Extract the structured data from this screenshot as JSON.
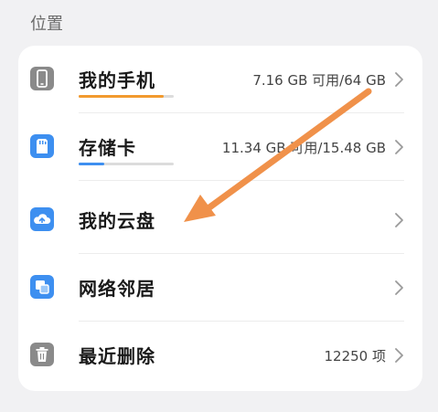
{
  "section": {
    "title": "位置"
  },
  "items": [
    {
      "label": "我的手机",
      "value": "7.16 GB 可用/64 GB",
      "icon": "phone-icon",
      "icon_color": "#8a8a8a",
      "usage_fraction": 0.89,
      "usage_color": "#f29a2e"
    },
    {
      "label": "存储卡",
      "value": "11.34 GB 可用/15.48 GB",
      "icon": "sd-card-icon",
      "icon_color": "#3d8ff0",
      "usage_fraction": 0.27,
      "usage_color": "#3d8ff0"
    },
    {
      "label": "我的云盘",
      "value": "",
      "icon": "cloud-drive-icon",
      "icon_color": "#3d8ff0"
    },
    {
      "label": "网络邻居",
      "value": "",
      "icon": "network-neighbor-icon",
      "icon_color": "#3d8ff0"
    },
    {
      "label": "最近删除",
      "value": "12250 项",
      "icon": "trash-icon",
      "icon_color": "#8a8a8a"
    }
  ],
  "annotation": {
    "arrow_color": "#f0914a"
  }
}
